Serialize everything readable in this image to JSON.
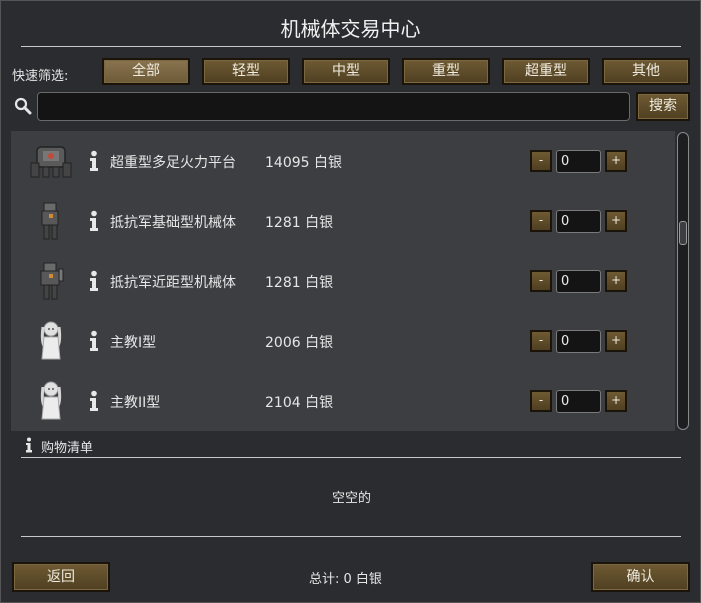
{
  "window": {
    "title": "机械体交易中心"
  },
  "filters": {
    "label": "快速筛选:",
    "items": [
      "全部",
      "轻型",
      "中型",
      "重型",
      "超重型",
      "其他"
    ],
    "active": "全部"
  },
  "search": {
    "value": "",
    "placeholder": "",
    "button_label": "搜索"
  },
  "items": [
    {
      "name": "超重型多足火力平台",
      "price": "14095 白银",
      "quantity": "0",
      "icon": "heavy-mech-icon"
    },
    {
      "name": "抵抗军基础型机械体",
      "price": "1281 白银",
      "quantity": "0",
      "icon": "resistance-mech-icon"
    },
    {
      "name": "抵抗军近距型机械体",
      "price": "1281 白银",
      "quantity": "0",
      "icon": "resistance-melee-mech-icon"
    },
    {
      "name": "主教I型",
      "price": "2006 白银",
      "quantity": "0",
      "icon": "bishop-mech-icon"
    },
    {
      "name": "主教II型",
      "price": "2104 白银",
      "quantity": "0",
      "icon": "bishop-mech-icon"
    }
  ],
  "stepper": {
    "minus": "-",
    "plus": "+"
  },
  "cart": {
    "title": "购物清单",
    "empty_text": "空空的"
  },
  "footer": {
    "total": "总计:  0 白银",
    "back_label": "返回",
    "confirm_label": "确认"
  },
  "colors": {
    "button": "#5e4b2a",
    "background": "#2a2c2f",
    "list_bg": "#3c3e41"
  }
}
